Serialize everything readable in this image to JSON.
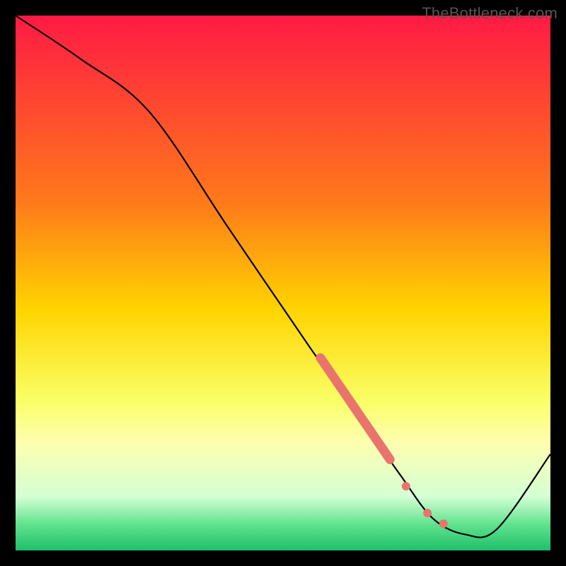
{
  "watermark": "TheBottleneck.com",
  "chart_data": {
    "type": "line",
    "title": "",
    "xlabel": "",
    "ylabel": "",
    "xlim": [
      0,
      100
    ],
    "ylim": [
      0,
      100
    ],
    "gradient_stops": [
      {
        "offset": 0,
        "color": "#ff1a44"
      },
      {
        "offset": 35,
        "color": "#ff7a1a"
      },
      {
        "offset": 55,
        "color": "#ffd400"
      },
      {
        "offset": 72,
        "color": "#faff66"
      },
      {
        "offset": 80,
        "color": "#fdffb0"
      },
      {
        "offset": 90,
        "color": "#d4ffd4"
      },
      {
        "offset": 95,
        "color": "#63e38f"
      },
      {
        "offset": 100,
        "color": "#1ec06a"
      }
    ],
    "series": [
      {
        "name": "bottleneck-curve",
        "color": "#000000",
        "x": [
          0,
          12,
          25,
          40,
          55,
          65,
          72,
          78,
          84,
          90,
          100
        ],
        "values": [
          100,
          92,
          82,
          60,
          38,
          24,
          14,
          6,
          3,
          4,
          18
        ]
      }
    ],
    "highlight_band": {
      "name": "highlighted-range",
      "color": "#e8746d",
      "x_start": 57,
      "x_end": 70,
      "y_start": 36,
      "y_end": 17
    },
    "highlight_points": [
      {
        "x": 73,
        "y": 12
      },
      {
        "x": 77,
        "y": 7
      },
      {
        "x": 80,
        "y": 5
      }
    ]
  }
}
